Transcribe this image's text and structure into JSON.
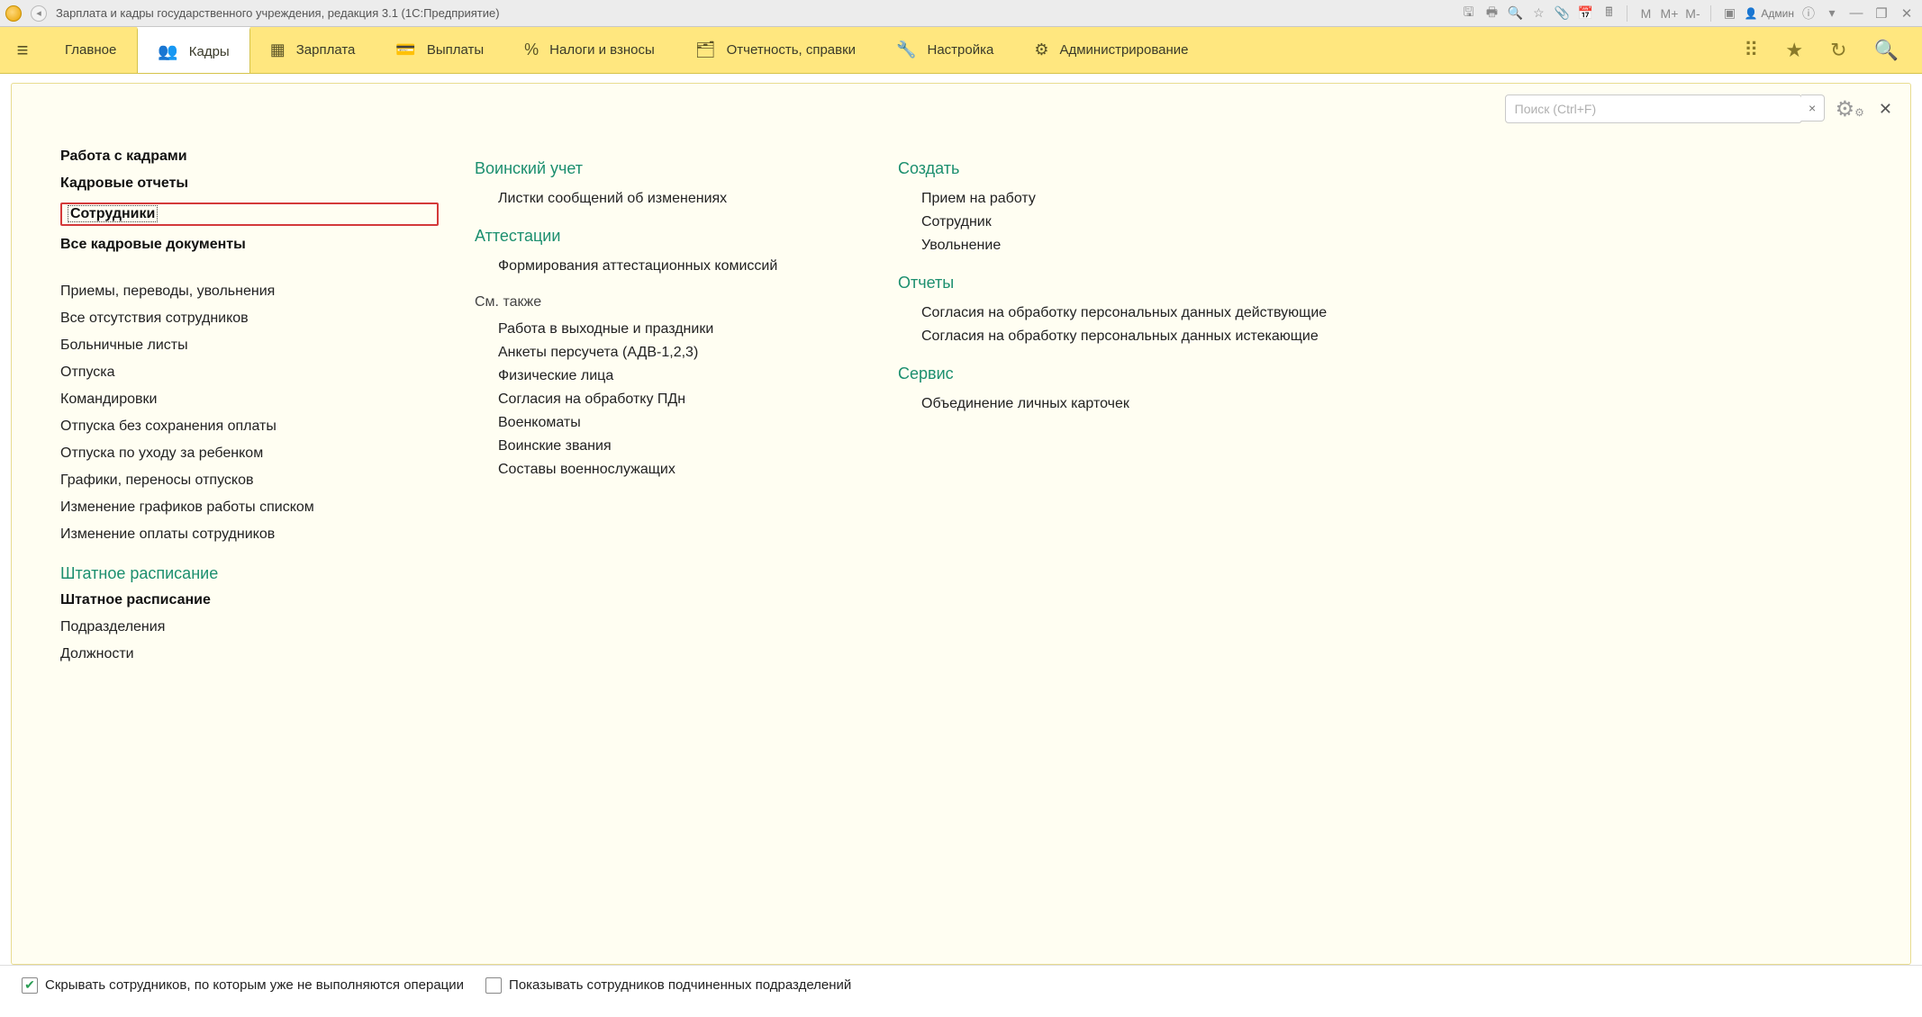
{
  "window": {
    "title": "Зарплата и кадры государственного учреждения, редакция 3.1  (1С:Предприятие)",
    "user_label": "Админ"
  },
  "sections": {
    "items": [
      {
        "icon": "≡",
        "label": "Главное"
      },
      {
        "icon": "👥",
        "label": "Кадры"
      },
      {
        "icon": "▦",
        "label": "Зарплата"
      },
      {
        "icon": "💳",
        "label": "Выплаты"
      },
      {
        "icon": "%",
        "label": "Налоги и взносы"
      },
      {
        "icon": "🗂",
        "label": "Отчетность, справки"
      },
      {
        "icon": "🔧",
        "label": "Настройка"
      },
      {
        "icon": "⚙",
        "label": "Администрирование"
      }
    ],
    "active_index": 1
  },
  "search": {
    "placeholder": "Поиск (Ctrl+F)"
  },
  "col1": {
    "top_strong": [
      "Работа с кадрами",
      "Кадровые отчеты",
      "Сотрудники",
      "Все кадровые документы"
    ],
    "highlight_index": 2,
    "flat_links": [
      "Приемы, переводы, увольнения",
      "Все отсутствия сотрудников",
      "Больничные листы",
      "Отпуска",
      "Командировки",
      "Отпуска без сохранения оплаты",
      "Отпуска по уходу за ребенком",
      "Графики, переносы отпусков",
      "Изменение графиков работы списком",
      "Изменение оплаты сотрудников"
    ],
    "staffing_heading": "Штатное расписание",
    "staffing_strong": "Штатное расписание",
    "staffing_links": [
      "Подразделения",
      "Должности"
    ]
  },
  "col2": {
    "sec1_heading": "Воинский учет",
    "sec1_links": [
      "Листки сообщений об изменениях"
    ],
    "sec2_heading": "Аттестации",
    "sec2_links": [
      "Формирования аттестационных комиссий"
    ],
    "see_also_heading": "См. также",
    "see_also_links": [
      "Работа в выходные и праздники",
      "Анкеты персучета (АДВ-1,2,3)",
      "Физические лица",
      "Согласия на обработку ПДн",
      "Военкоматы",
      "Воинские звания",
      "Составы военнослужащих"
    ]
  },
  "col3": {
    "create_heading": "Создать",
    "create_links": [
      "Прием на работу",
      "Сотрудник",
      "Увольнение"
    ],
    "reports_heading": "Отчеты",
    "reports_links": [
      "Согласия на обработку персональных данных действующие",
      "Согласия на обработку персональных данных истекающие"
    ],
    "service_heading": "Сервис",
    "service_links": [
      "Объединение личных карточек"
    ]
  },
  "bottom": {
    "hide_label": "Скрывать сотрудников, по которым уже не выполняются операции",
    "show_label": "Показывать сотрудников подчиненных подразделений",
    "hide_checked": true,
    "show_checked": false
  }
}
